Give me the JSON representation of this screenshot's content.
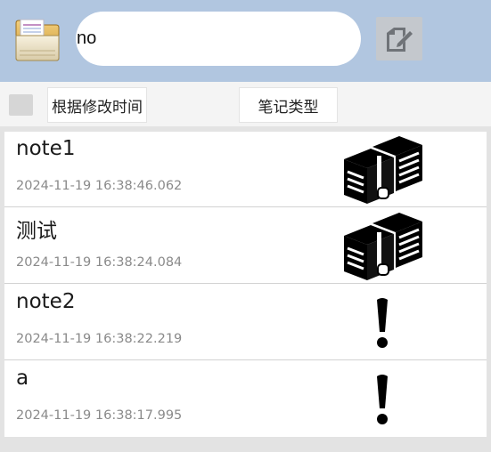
{
  "search": {
    "value": "no"
  },
  "filter": {
    "sort_label": "根据修改时间",
    "type_label": "笔记类型",
    "checkbox_checked": false
  },
  "notes": [
    {
      "title": "note1",
      "time": "2024-11-19 16:38:46.062",
      "icon": "database-server-icon"
    },
    {
      "title": "测试",
      "time": "2024-11-19 16:38:24.084",
      "icon": "database-server-icon"
    },
    {
      "title": "note2",
      "time": "2024-11-19 16:38:22.219",
      "icon": "exclamation-icon"
    },
    {
      "title": "a",
      "time": "2024-11-19 16:38:17.995",
      "icon": "exclamation-icon"
    }
  ],
  "colors": {
    "header_bg": "#b1c6e0",
    "filter_bg": "#f4f4f4",
    "page_bg": "#e3e3e3",
    "edit_button_bg": "#c4c8cd"
  }
}
